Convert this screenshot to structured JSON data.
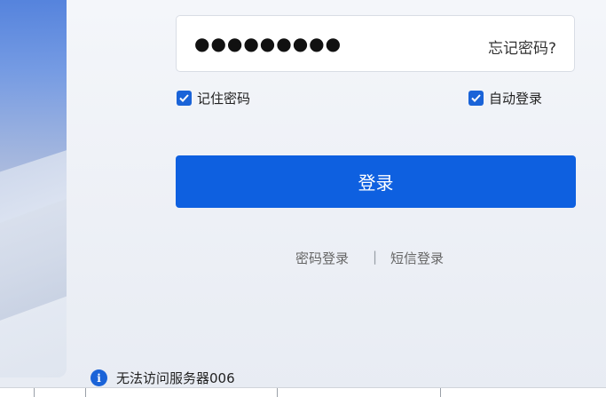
{
  "password": {
    "masked_value": "●●●●●●●●●",
    "forgot_label": "忘记密码?"
  },
  "options": {
    "remember_password": {
      "label": "记住密码",
      "checked": true
    },
    "auto_login": {
      "label": "自动登录",
      "checked": true
    }
  },
  "login_button_label": "登录",
  "login_modes": {
    "password_login": "密码登录",
    "separator": "|",
    "sms_login": "短信登录"
  },
  "status": {
    "icon": "info-icon",
    "message": "无法访问服务器006"
  },
  "colors": {
    "accent": "#0e60e0",
    "checkbox": "#1a63d8"
  }
}
